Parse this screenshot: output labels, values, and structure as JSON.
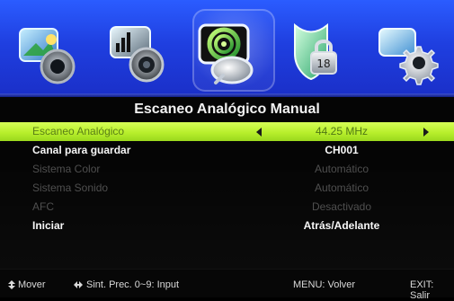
{
  "title": "Escaneo Analógico Manual",
  "menu": {
    "items": [
      {
        "label": "Escaneo Analógico",
        "value": "44.25 MHz",
        "state": "active"
      },
      {
        "label": "Canal para guardar",
        "value": "CH001",
        "state": "white"
      },
      {
        "label": "Sistema Color",
        "value": "Automático",
        "state": "gray"
      },
      {
        "label": "Sistema Sonido",
        "value": "Automático",
        "state": "gray"
      },
      {
        "label": "AFC",
        "value": "Desactivado",
        "state": "gray"
      },
      {
        "label": "Iniciar",
        "value": "Atrás/Adelante",
        "state": "white"
      }
    ]
  },
  "footer": {
    "left": "Mover",
    "nav_hint": "Sint. Prec. 0~9: Input",
    "menu_hint": "MENU: Volver",
    "exit_hint": "EXIT: Salir"
  },
  "icons": [
    "picture-icon",
    "audio-icon",
    "channel-satellite-icon",
    "lock-icon",
    "setup-gear-icon"
  ],
  "colors": {
    "top_bar_blue": "#1f3fe0",
    "active_row_green": "#b8ef2c"
  }
}
